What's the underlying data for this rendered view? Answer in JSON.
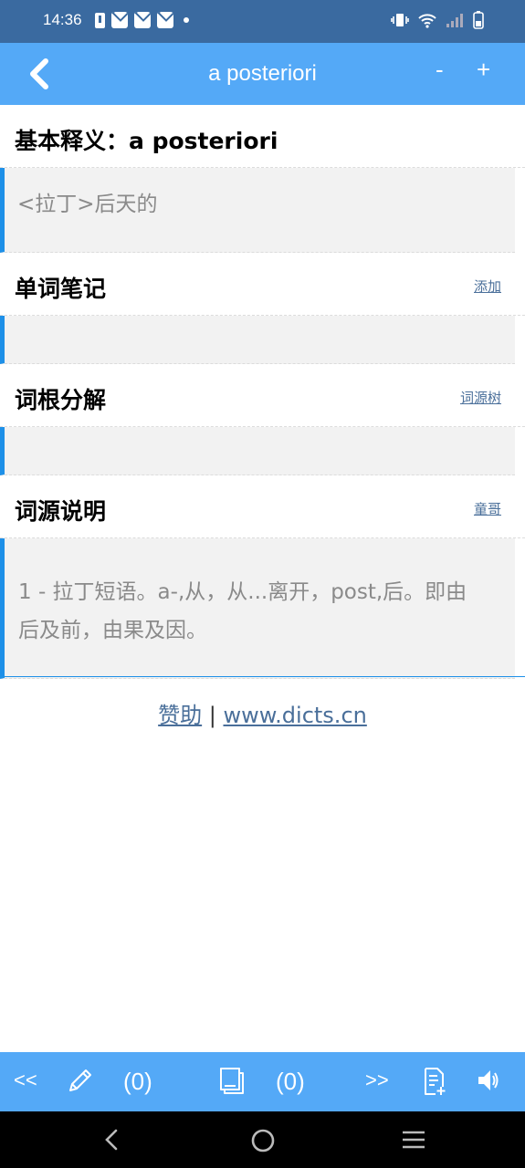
{
  "status_bar": {
    "time": "14:36"
  },
  "header": {
    "title": "a posteriori",
    "zoom_out": "-",
    "zoom_in": "+"
  },
  "sections": {
    "definition": {
      "title": "基本释义：a posteriori",
      "text": "<拉丁>后天的"
    },
    "notes": {
      "title": "单词笔记",
      "link": "添加"
    },
    "roots": {
      "title": "词根分解",
      "link": "词源树"
    },
    "etymology": {
      "title": "词源说明",
      "link": "童哥",
      "text": "1 - 拉丁短语。a-,从，从...离开，post,后。即由后及前，由果及因。"
    }
  },
  "footer": {
    "sponsor": "赞助",
    "separator": " | ",
    "site": "www.dicts.cn"
  },
  "toolbar": {
    "prev": "<<",
    "note_count": "(0)",
    "book_count": "(0)",
    "next": ">>"
  },
  "colors": {
    "status_bar": "#3a6aa0",
    "header": "#54a9f7",
    "accent": "#1e90e8"
  }
}
